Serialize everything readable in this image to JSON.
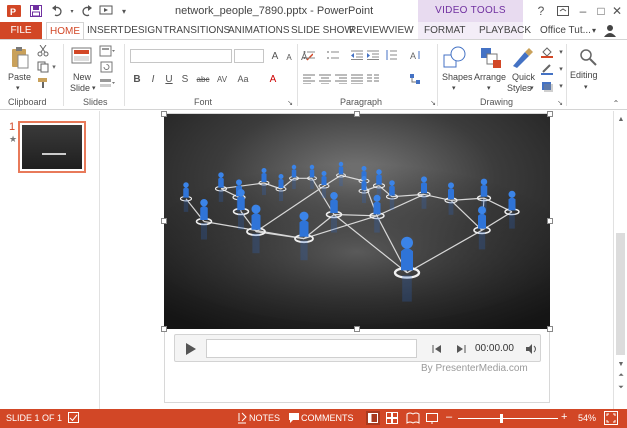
{
  "titlebar": {
    "title": "network_people_7890.pptx - PowerPoint",
    "context_group": "VIDEO TOOLS",
    "icons": [
      "powerpoint-logo-icon",
      "save-icon",
      "undo-icon",
      "redo-icon",
      "start-from-beginning-icon",
      "customize-qat-icon",
      "help-icon",
      "ribbon-display-icon",
      "minimize-icon",
      "maximize-icon",
      "close-icon"
    ],
    "help": "?",
    "minimize": "–",
    "maximize": "□",
    "close": "✕"
  },
  "tabs": {
    "file": "FILE",
    "home": "HOME",
    "insert": "INSERT",
    "design": "DESIGN",
    "transitions": "TRANSITIONS",
    "animations": "ANIMATIONS",
    "slideshow": "SLIDE SHOW",
    "review": "REVIEW",
    "view": "VIEW",
    "format": "FORMAT",
    "playback": "PLAYBACK",
    "account": "Office Tut...",
    "account_caret": "▾"
  },
  "ribbon": {
    "clipboard": {
      "label": "Clipboard",
      "paste": "Paste"
    },
    "slides": {
      "label": "Slides",
      "new_slide_1": "New",
      "new_slide_2": "Slide"
    },
    "font": {
      "label": "Font",
      "bold": "B",
      "italic": "I",
      "underline": "U",
      "shadow": "S",
      "strike": "abc",
      "spacing": "AV",
      "case": "Aa",
      "grow": "A",
      "shrink": "A",
      "color": "A"
    },
    "paragraph": {
      "label": "Paragraph"
    },
    "drawing": {
      "label": "Drawing",
      "shapes": "Shapes",
      "arrange": "Arrange",
      "quick_styles_1": "Quick",
      "quick_styles_2": "Styles"
    },
    "editing": {
      "label": "Editing"
    }
  },
  "thumbnails": {
    "slide_number": "1",
    "star": "★"
  },
  "player": {
    "time": "00:00.00",
    "credit": "By PresenterMedia.com"
  },
  "statusbar": {
    "slide_info": "SLIDE 1 OF 1",
    "notes": "NOTES",
    "comments": "COMMENTS",
    "zoom_minus": "–",
    "zoom_plus": "+",
    "zoom": "54%"
  },
  "colors": {
    "accent": "#d24726",
    "video_tools": "#7030a0"
  }
}
